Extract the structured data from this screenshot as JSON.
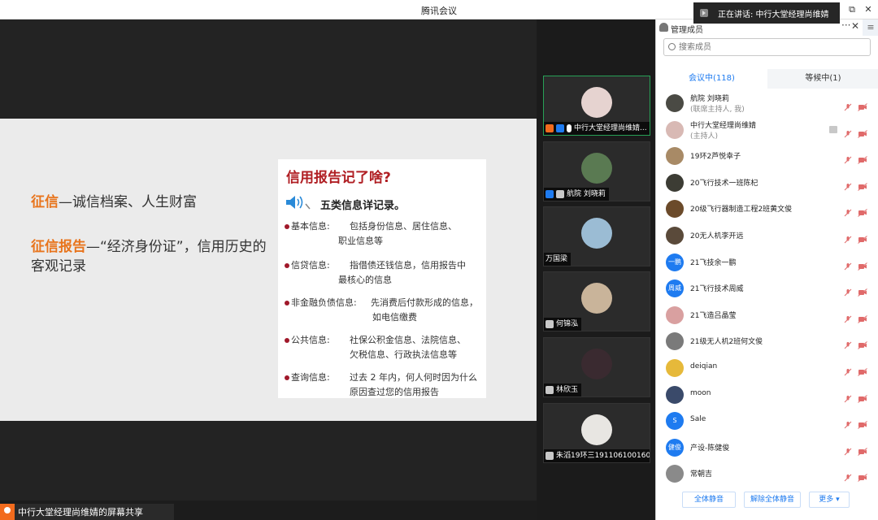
{
  "window": {
    "title": "腾讯会议",
    "speaking_text": "正在讲话: 中行大堂经理尚维婧"
  },
  "slide": {
    "def1_term": "征信",
    "def1_rest": "—诚信档案、人生财富",
    "def2_term": "征信报告",
    "def2_rest": "—“经济身份证”，信用历史的客观记录",
    "card_title": "信用报告记了啥?",
    "card_subtitle": "五类信息详记录。",
    "rows": [
      {
        "label": "基本信息:",
        "line1": "包括身份信息、居住信息、",
        "line2": "职业信息等"
      },
      {
        "label": "信贷信息:",
        "line1": "指借债还钱信息，信用报告中",
        "line2": "最核心的信息"
      },
      {
        "label": "非金融负债信息:",
        "line1": "先消费后付款形成的信息，",
        "line2": "如电信缴费"
      },
      {
        "label": "公共信息:",
        "line1": "社保公积金信息、法院信息、",
        "line2": "欠税信息、行政执法信息等"
      },
      {
        "label": "查询信息:",
        "line1": "过去 2 年内，何人何时因为什么",
        "line2": "原因查过您的信用报告"
      }
    ]
  },
  "share_label": "中行大堂经理尚维婧的屏幕共享",
  "videos": [
    {
      "name": "中行大堂经理尚维婧...",
      "active": true,
      "avatar_color": "#e6d3d0"
    },
    {
      "name": "航院 刘晓莉",
      "active": false,
      "avatar_color": "#5a7a52"
    },
    {
      "name": "万国梁",
      "active": false,
      "avatar_color": "#9bbcd4"
    },
    {
      "name": "何锦泓",
      "active": false,
      "avatar_color": "#c9b49a"
    },
    {
      "name": "林欣玉",
      "active": false,
      "avatar_color": "#3a2a30"
    },
    {
      "name": "朱滔19环三191106100160",
      "active": false,
      "avatar_color": "#e8e6e2"
    }
  ],
  "panel": {
    "title": "管理成员",
    "more": "···",
    "close": "✕",
    "side": "≡",
    "search_placeholder": "搜索成员",
    "tab_in": "会议中(118)",
    "tab_wait": "等候中(1)",
    "members": [
      {
        "name": "航院 刘晓莉",
        "role": "(联席主持人, 我)",
        "avatar_text": "",
        "avatar_color": "#4a4a44",
        "screen": false
      },
      {
        "name": "中行大堂经理尚维婧",
        "role": "(主持人)",
        "avatar_text": "",
        "avatar_color": "#d8b9b4",
        "screen": true
      },
      {
        "name": "19环2芦悦幸子",
        "role": "",
        "avatar_text": "",
        "avatar_color": "#a88a66",
        "screen": false
      },
      {
        "name": "20飞行技术一班陈杞",
        "role": "",
        "avatar_text": "",
        "avatar_color": "#3c3c34",
        "screen": false
      },
      {
        "name": "20级飞行器制造工程2班黄文俊",
        "role": "",
        "avatar_text": "",
        "avatar_color": "#6b4a2a",
        "screen": false
      },
      {
        "name": "20无人机李开远",
        "role": "",
        "avatar_text": "",
        "avatar_color": "#5a4a3a",
        "screen": false
      },
      {
        "name": "21飞技余一鹏",
        "role": "",
        "avatar_text": "一鹏",
        "avatar_color": "#1e7bf0",
        "screen": false
      },
      {
        "name": "21飞行技术周威",
        "role": "",
        "avatar_text": "周威",
        "avatar_color": "#1e7bf0",
        "screen": false
      },
      {
        "name": "21飞造吕晶莹",
        "role": "",
        "avatar_text": "",
        "avatar_color": "#d9a0a0",
        "screen": false
      },
      {
        "name": "21级无人机2班何文俊",
        "role": "",
        "avatar_text": "",
        "avatar_color": "#7a7a7a",
        "screen": false
      },
      {
        "name": "deiqian",
        "role": "",
        "avatar_text": "",
        "avatar_color": "#e6b93a",
        "screen": false
      },
      {
        "name": "moon",
        "role": "",
        "avatar_text": "",
        "avatar_color": "#3a4a6a",
        "screen": false
      },
      {
        "name": "Sale",
        "role": "",
        "avatar_text": "S",
        "avatar_color": "#1e7bf0",
        "screen": false
      },
      {
        "name": "产设-陈健俊",
        "role": "",
        "avatar_text": "健俊",
        "avatar_color": "#1e7bf0",
        "screen": false
      },
      {
        "name": "常朝吉",
        "role": "",
        "avatar_text": "",
        "avatar_color": "#8a8a8a",
        "screen": false
      }
    ],
    "mute_all": "全体静音",
    "unmute_all": "解除全体静音",
    "more_btn": "更多 ▾"
  },
  "colors": {
    "accent": "#1e7bf0",
    "orange": "#e8741c",
    "card_red": "#b01e23",
    "muted_red": "#e06a6a"
  }
}
